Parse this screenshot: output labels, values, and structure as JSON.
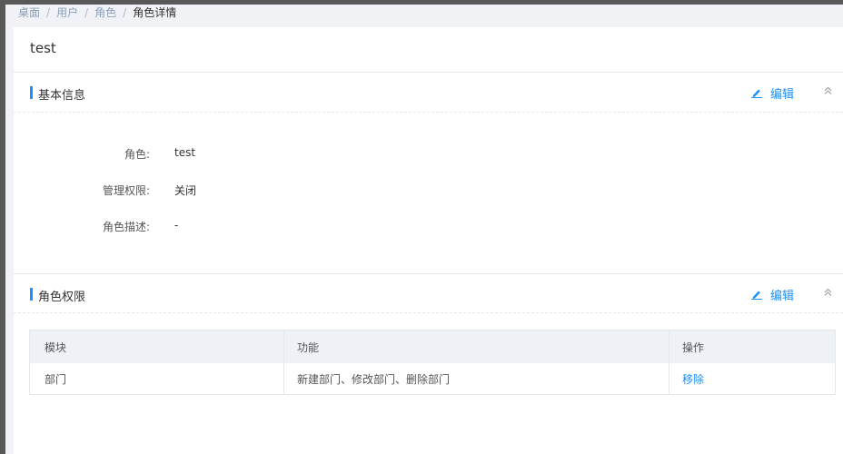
{
  "breadcrumb": {
    "items": [
      "桌面",
      "用户",
      "角色"
    ],
    "current": "角色详情",
    "separator": "/"
  },
  "page": {
    "title": "test"
  },
  "basic_info": {
    "title": "基本信息",
    "edit_label": "编辑",
    "fields": [
      {
        "label": "角色:",
        "value": "test"
      },
      {
        "label": "管理权限:",
        "value": "关闭"
      },
      {
        "label": "角色描述:",
        "value": "-"
      }
    ]
  },
  "permissions": {
    "title": "角色权限",
    "edit_label": "编辑",
    "columns": [
      "模块",
      "功能",
      "操作"
    ],
    "rows": [
      {
        "module": "部门",
        "functions": "新建部门、修改部门、删除部门",
        "action": "移除"
      }
    ]
  },
  "colors": {
    "accent": "#1890ff",
    "table_header": "#eef1f6",
    "background": "#f0f2f5"
  }
}
